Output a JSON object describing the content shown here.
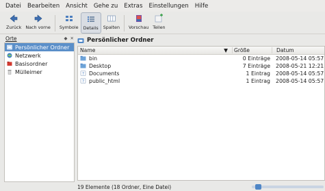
{
  "menu": [
    "Datei",
    "Bearbeiten",
    "Ansicht",
    "Gehe zu",
    "Extras",
    "Einstellungen",
    "Hilfe"
  ],
  "toolbar": {
    "back": "Zurück",
    "forward": "Nach vorne",
    "icons": "Symbole",
    "details": "Details",
    "columns": "Spalten",
    "preview": "Vorschau",
    "split": "Teilen"
  },
  "places": {
    "title": "Orte",
    "items": [
      {
        "label": "Persönlicher Ordner",
        "icon": "home-icon"
      },
      {
        "label": "Netzwerk",
        "icon": "network-icon"
      },
      {
        "label": "Basisordner",
        "icon": "root-folder-icon"
      },
      {
        "label": "Mülleimer",
        "icon": "trash-icon"
      }
    ]
  },
  "location": {
    "title": "Persönlicher Ordner"
  },
  "columns": {
    "name": "Name",
    "size": "Größe",
    "date": "Datum"
  },
  "files": [
    {
      "name": "bin",
      "size": "0 Einträge",
      "date": "2008-05-14 05:57",
      "icon": "folder-icon"
    },
    {
      "name": "Desktop",
      "size": "7 Einträge",
      "date": "2008-05-21 12:21",
      "icon": "folder-icon"
    },
    {
      "name": "Documents",
      "size": "1 Eintrag",
      "date": "2008-05-14 05:57",
      "icon": "folder-icon"
    },
    {
      "name": "public_html",
      "size": "1 Eintrag",
      "date": "2008-05-14 05:57",
      "icon": "folder-icon"
    }
  ],
  "status": {
    "text": "19 Elemente (18 Ordner, Eine Datei)",
    "zoom_level": 0.05
  },
  "colors": {
    "selection": "#5b8fc9",
    "folder": "#6ea3d8",
    "accent": "#4f86c6"
  }
}
